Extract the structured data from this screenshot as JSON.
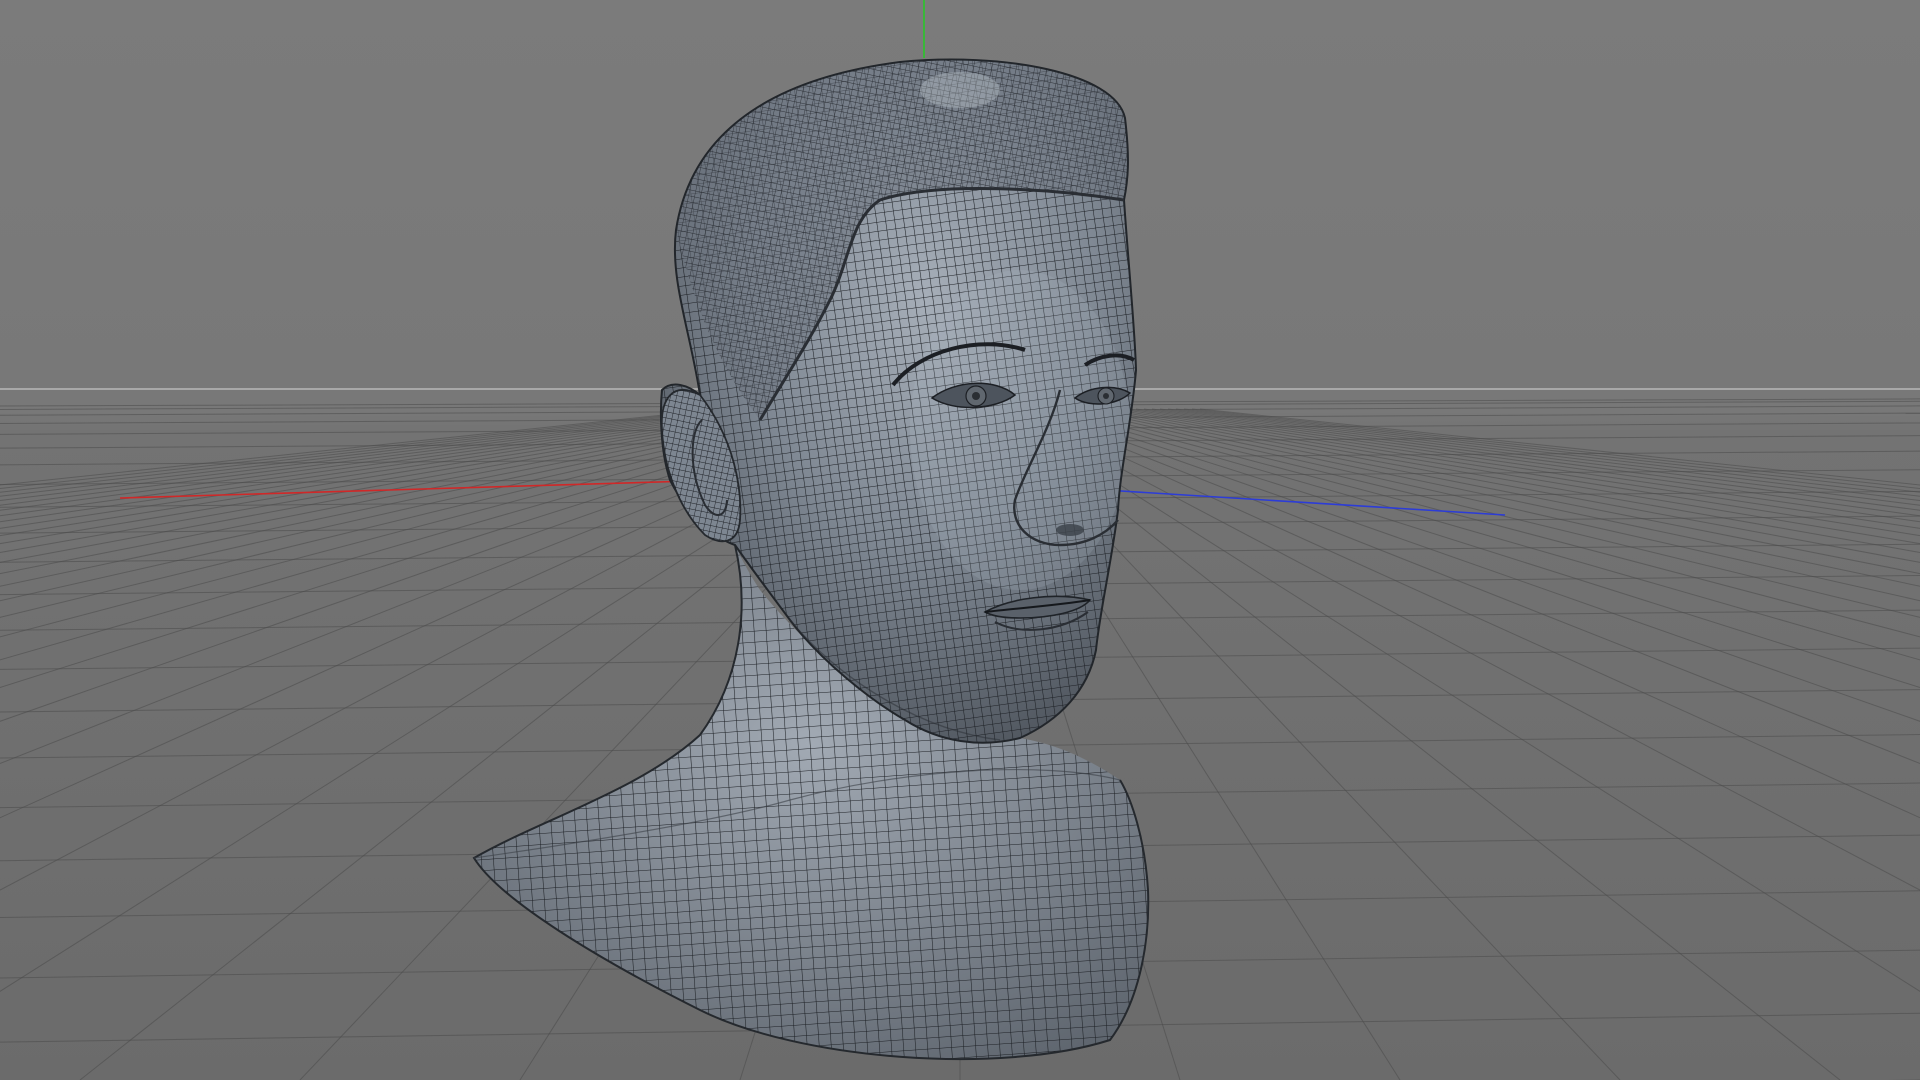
{
  "viewport": {
    "mode": "wireframe-shaded",
    "object": "head-bust-mesh",
    "background_top_color": "#7b7b7b",
    "background_bottom_color": "#6c6c6c",
    "grid_color": "#4a4a4a",
    "horizon_color": "#b9b9b9",
    "mesh_fill_color": "#8c95a0",
    "mesh_wire_color": "#1b1e23",
    "axis_colors": {
      "x": "#d02828",
      "y": "#28c828",
      "z": "#2c3cd8"
    }
  }
}
